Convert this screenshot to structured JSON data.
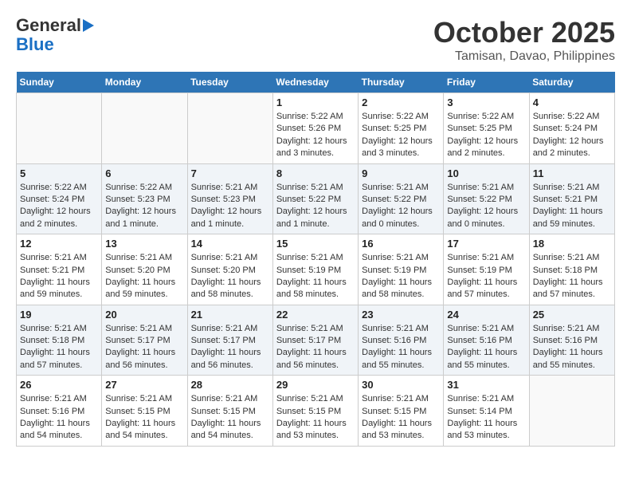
{
  "header": {
    "logo_line1": "General",
    "logo_line2": "Blue",
    "month": "October 2025",
    "location": "Tamisan, Davao, Philippines"
  },
  "days_of_week": [
    "Sunday",
    "Monday",
    "Tuesday",
    "Wednesday",
    "Thursday",
    "Friday",
    "Saturday"
  ],
  "weeks": [
    [
      {
        "day": "",
        "info": ""
      },
      {
        "day": "",
        "info": ""
      },
      {
        "day": "",
        "info": ""
      },
      {
        "day": "1",
        "info": "Sunrise: 5:22 AM\nSunset: 5:26 PM\nDaylight: 12 hours\nand 3 minutes."
      },
      {
        "day": "2",
        "info": "Sunrise: 5:22 AM\nSunset: 5:25 PM\nDaylight: 12 hours\nand 3 minutes."
      },
      {
        "day": "3",
        "info": "Sunrise: 5:22 AM\nSunset: 5:25 PM\nDaylight: 12 hours\nand 2 minutes."
      },
      {
        "day": "4",
        "info": "Sunrise: 5:22 AM\nSunset: 5:24 PM\nDaylight: 12 hours\nand 2 minutes."
      }
    ],
    [
      {
        "day": "5",
        "info": "Sunrise: 5:22 AM\nSunset: 5:24 PM\nDaylight: 12 hours\nand 2 minutes."
      },
      {
        "day": "6",
        "info": "Sunrise: 5:22 AM\nSunset: 5:23 PM\nDaylight: 12 hours\nand 1 minute."
      },
      {
        "day": "7",
        "info": "Sunrise: 5:21 AM\nSunset: 5:23 PM\nDaylight: 12 hours\nand 1 minute."
      },
      {
        "day": "8",
        "info": "Sunrise: 5:21 AM\nSunset: 5:22 PM\nDaylight: 12 hours\nand 1 minute."
      },
      {
        "day": "9",
        "info": "Sunrise: 5:21 AM\nSunset: 5:22 PM\nDaylight: 12 hours\nand 0 minutes."
      },
      {
        "day": "10",
        "info": "Sunrise: 5:21 AM\nSunset: 5:22 PM\nDaylight: 12 hours\nand 0 minutes."
      },
      {
        "day": "11",
        "info": "Sunrise: 5:21 AM\nSunset: 5:21 PM\nDaylight: 11 hours\nand 59 minutes."
      }
    ],
    [
      {
        "day": "12",
        "info": "Sunrise: 5:21 AM\nSunset: 5:21 PM\nDaylight: 11 hours\nand 59 minutes."
      },
      {
        "day": "13",
        "info": "Sunrise: 5:21 AM\nSunset: 5:20 PM\nDaylight: 11 hours\nand 59 minutes."
      },
      {
        "day": "14",
        "info": "Sunrise: 5:21 AM\nSunset: 5:20 PM\nDaylight: 11 hours\nand 58 minutes."
      },
      {
        "day": "15",
        "info": "Sunrise: 5:21 AM\nSunset: 5:19 PM\nDaylight: 11 hours\nand 58 minutes."
      },
      {
        "day": "16",
        "info": "Sunrise: 5:21 AM\nSunset: 5:19 PM\nDaylight: 11 hours\nand 58 minutes."
      },
      {
        "day": "17",
        "info": "Sunrise: 5:21 AM\nSunset: 5:19 PM\nDaylight: 11 hours\nand 57 minutes."
      },
      {
        "day": "18",
        "info": "Sunrise: 5:21 AM\nSunset: 5:18 PM\nDaylight: 11 hours\nand 57 minutes."
      }
    ],
    [
      {
        "day": "19",
        "info": "Sunrise: 5:21 AM\nSunset: 5:18 PM\nDaylight: 11 hours\nand 57 minutes."
      },
      {
        "day": "20",
        "info": "Sunrise: 5:21 AM\nSunset: 5:17 PM\nDaylight: 11 hours\nand 56 minutes."
      },
      {
        "day": "21",
        "info": "Sunrise: 5:21 AM\nSunset: 5:17 PM\nDaylight: 11 hours\nand 56 minutes."
      },
      {
        "day": "22",
        "info": "Sunrise: 5:21 AM\nSunset: 5:17 PM\nDaylight: 11 hours\nand 56 minutes."
      },
      {
        "day": "23",
        "info": "Sunrise: 5:21 AM\nSunset: 5:16 PM\nDaylight: 11 hours\nand 55 minutes."
      },
      {
        "day": "24",
        "info": "Sunrise: 5:21 AM\nSunset: 5:16 PM\nDaylight: 11 hours\nand 55 minutes."
      },
      {
        "day": "25",
        "info": "Sunrise: 5:21 AM\nSunset: 5:16 PM\nDaylight: 11 hours\nand 55 minutes."
      }
    ],
    [
      {
        "day": "26",
        "info": "Sunrise: 5:21 AM\nSunset: 5:16 PM\nDaylight: 11 hours\nand 54 minutes."
      },
      {
        "day": "27",
        "info": "Sunrise: 5:21 AM\nSunset: 5:15 PM\nDaylight: 11 hours\nand 54 minutes."
      },
      {
        "day": "28",
        "info": "Sunrise: 5:21 AM\nSunset: 5:15 PM\nDaylight: 11 hours\nand 54 minutes."
      },
      {
        "day": "29",
        "info": "Sunrise: 5:21 AM\nSunset: 5:15 PM\nDaylight: 11 hours\nand 53 minutes."
      },
      {
        "day": "30",
        "info": "Sunrise: 5:21 AM\nSunset: 5:15 PM\nDaylight: 11 hours\nand 53 minutes."
      },
      {
        "day": "31",
        "info": "Sunrise: 5:21 AM\nSunset: 5:14 PM\nDaylight: 11 hours\nand 53 minutes."
      },
      {
        "day": "",
        "info": ""
      }
    ]
  ]
}
